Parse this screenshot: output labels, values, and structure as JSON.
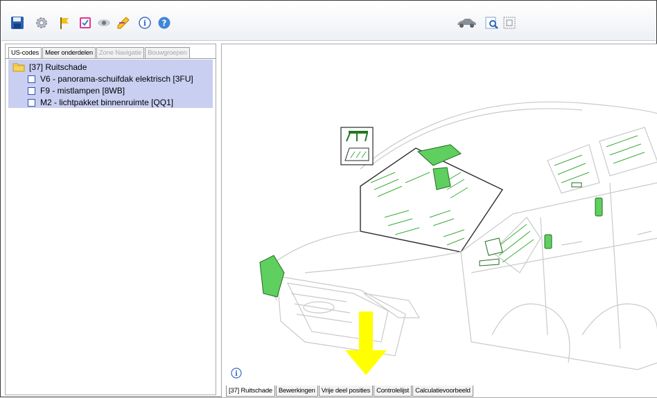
{
  "toolbar": {
    "left_icons": [
      "save-icon",
      "settings-icon",
      "flag-icon",
      "checklist-icon",
      "eye-icon",
      "pencil-edit-icon",
      "info-icon",
      "help-icon"
    ],
    "right_icons": [
      "car-icon",
      "zoom-icon",
      "fit-view-icon"
    ]
  },
  "left_tabs": [
    {
      "label": "US-codes",
      "state": "active"
    },
    {
      "label": "Meer onderdelen",
      "state": "normal"
    },
    {
      "label": "Zone Navigatie",
      "state": "disabled"
    },
    {
      "label": "Bouwgroepen",
      "state": "disabled"
    }
  ],
  "tree": {
    "root": "[37] Ruitschade",
    "items": [
      {
        "label": "V6 - panorama-schuifdak elektrisch [3FU]",
        "checked": false
      },
      {
        "label": "F9 - mistlampen [8WB]",
        "checked": false
      },
      {
        "label": "M2 - lichtpakket binnenruimte [QQ1]",
        "checked": false
      }
    ]
  },
  "bottom_tabs": [
    {
      "label": "[37] Ruitschade",
      "state": "active"
    },
    {
      "label": "Bewerkingen",
      "state": "normal"
    },
    {
      "label": "Vrije deel posities",
      "state": "normal"
    },
    {
      "label": "Controlelijst",
      "state": "normal"
    },
    {
      "label": "Calculatievoorbeeld",
      "state": "normal"
    }
  ],
  "colors": {
    "highlight_green": "#5fcf5f",
    "selection_blue": "#c9cff1",
    "arrow_yellow": "#ffff00"
  }
}
